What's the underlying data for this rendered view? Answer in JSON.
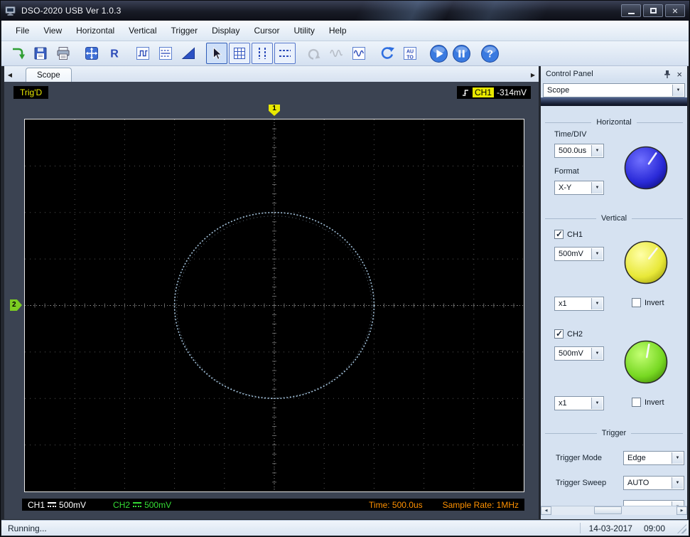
{
  "window": {
    "title": "DSO-2020 USB Ver 1.0.3"
  },
  "menu": {
    "items": [
      "File",
      "View",
      "Horizontal",
      "Vertical",
      "Trigger",
      "Display",
      "Cursor",
      "Utility",
      "Help"
    ]
  },
  "toolbar": {
    "r_label": "R",
    "auto_top": "AU",
    "auto_bottom": "TO",
    "help_glyph": "?",
    "icons": [
      "open",
      "save",
      "print",
      "auto-set",
      "record-r",
      "square-wave",
      "filter-levels",
      "ramp",
      "select-cursor",
      "grid",
      "vertical-cursors",
      "horizontal-cursors",
      "undo",
      "waveform-disabled",
      "waveform",
      "refresh",
      "auto-scale",
      "play",
      "pause",
      "help"
    ],
    "disabled_icons": [
      "undo",
      "waveform-disabled"
    ]
  },
  "tabs": {
    "scope_label": "Scope"
  },
  "scope": {
    "trig_status": "Trig'D",
    "trigger_readout": {
      "channel": "CH1",
      "value": "-314mV"
    },
    "marker_top": "1",
    "marker_left": "2",
    "channel1": {
      "label": "CH1",
      "volts": "500mV",
      "color": "#ffffff"
    },
    "channel2": {
      "label": "CH2",
      "volts": "500mV",
      "color": "#35dd35"
    },
    "time_label": "Time: 500.0us",
    "sample_rate_label": "Sample Rate: 1MHz",
    "display": {
      "h_divisions": 10,
      "v_divisions": 8,
      "grid_color": "#565656",
      "trace": {
        "type": "xy-ellipse",
        "cx_div": 0,
        "cy_div": 0,
        "rx_div": 2.0,
        "ry_div": 2.0,
        "color": "#a9c9e4"
      }
    }
  },
  "control_panel": {
    "title": "Control Panel",
    "panel_selector": "Scope",
    "horizontal": {
      "title": "Horizontal",
      "time_div_label": "Time/DIV",
      "time_div_value": "500.0us",
      "format_label": "Format",
      "format_value": "X-Y",
      "knob": {
        "color": "#2a2ad8",
        "hilite": "#7070ff",
        "edge": "#13138f",
        "pointer": "#eeeeff",
        "angle": 35
      }
    },
    "vertical": {
      "title": "Vertical",
      "ch1": {
        "label": "CH1",
        "checked": true,
        "volts_value": "500mV",
        "probe_value": "x1",
        "invert_label": "Invert",
        "invert_checked": false,
        "knob": {
          "color": "#e8e838",
          "hilite": "#ffffa8",
          "edge": "#aeae16",
          "pointer": "#f8f8f8",
          "angle": 38
        }
      },
      "ch2": {
        "label": "CH2",
        "checked": true,
        "volts_value": "500mV",
        "probe_value": "x1",
        "invert_label": "Invert",
        "invert_checked": false,
        "knob": {
          "color": "#77d822",
          "hilite": "#c4ff74",
          "edge": "#4d990d",
          "pointer": "#f8f8f8",
          "angle": 10
        }
      }
    },
    "trigger": {
      "title": "Trigger",
      "mode_label": "Trigger Mode",
      "mode_value": "Edge",
      "sweep_label": "Trigger Sweep",
      "sweep_value": "AUTO"
    }
  },
  "statusbar": {
    "status": "Running...",
    "date": "14-03-2017",
    "time": "09:00"
  }
}
